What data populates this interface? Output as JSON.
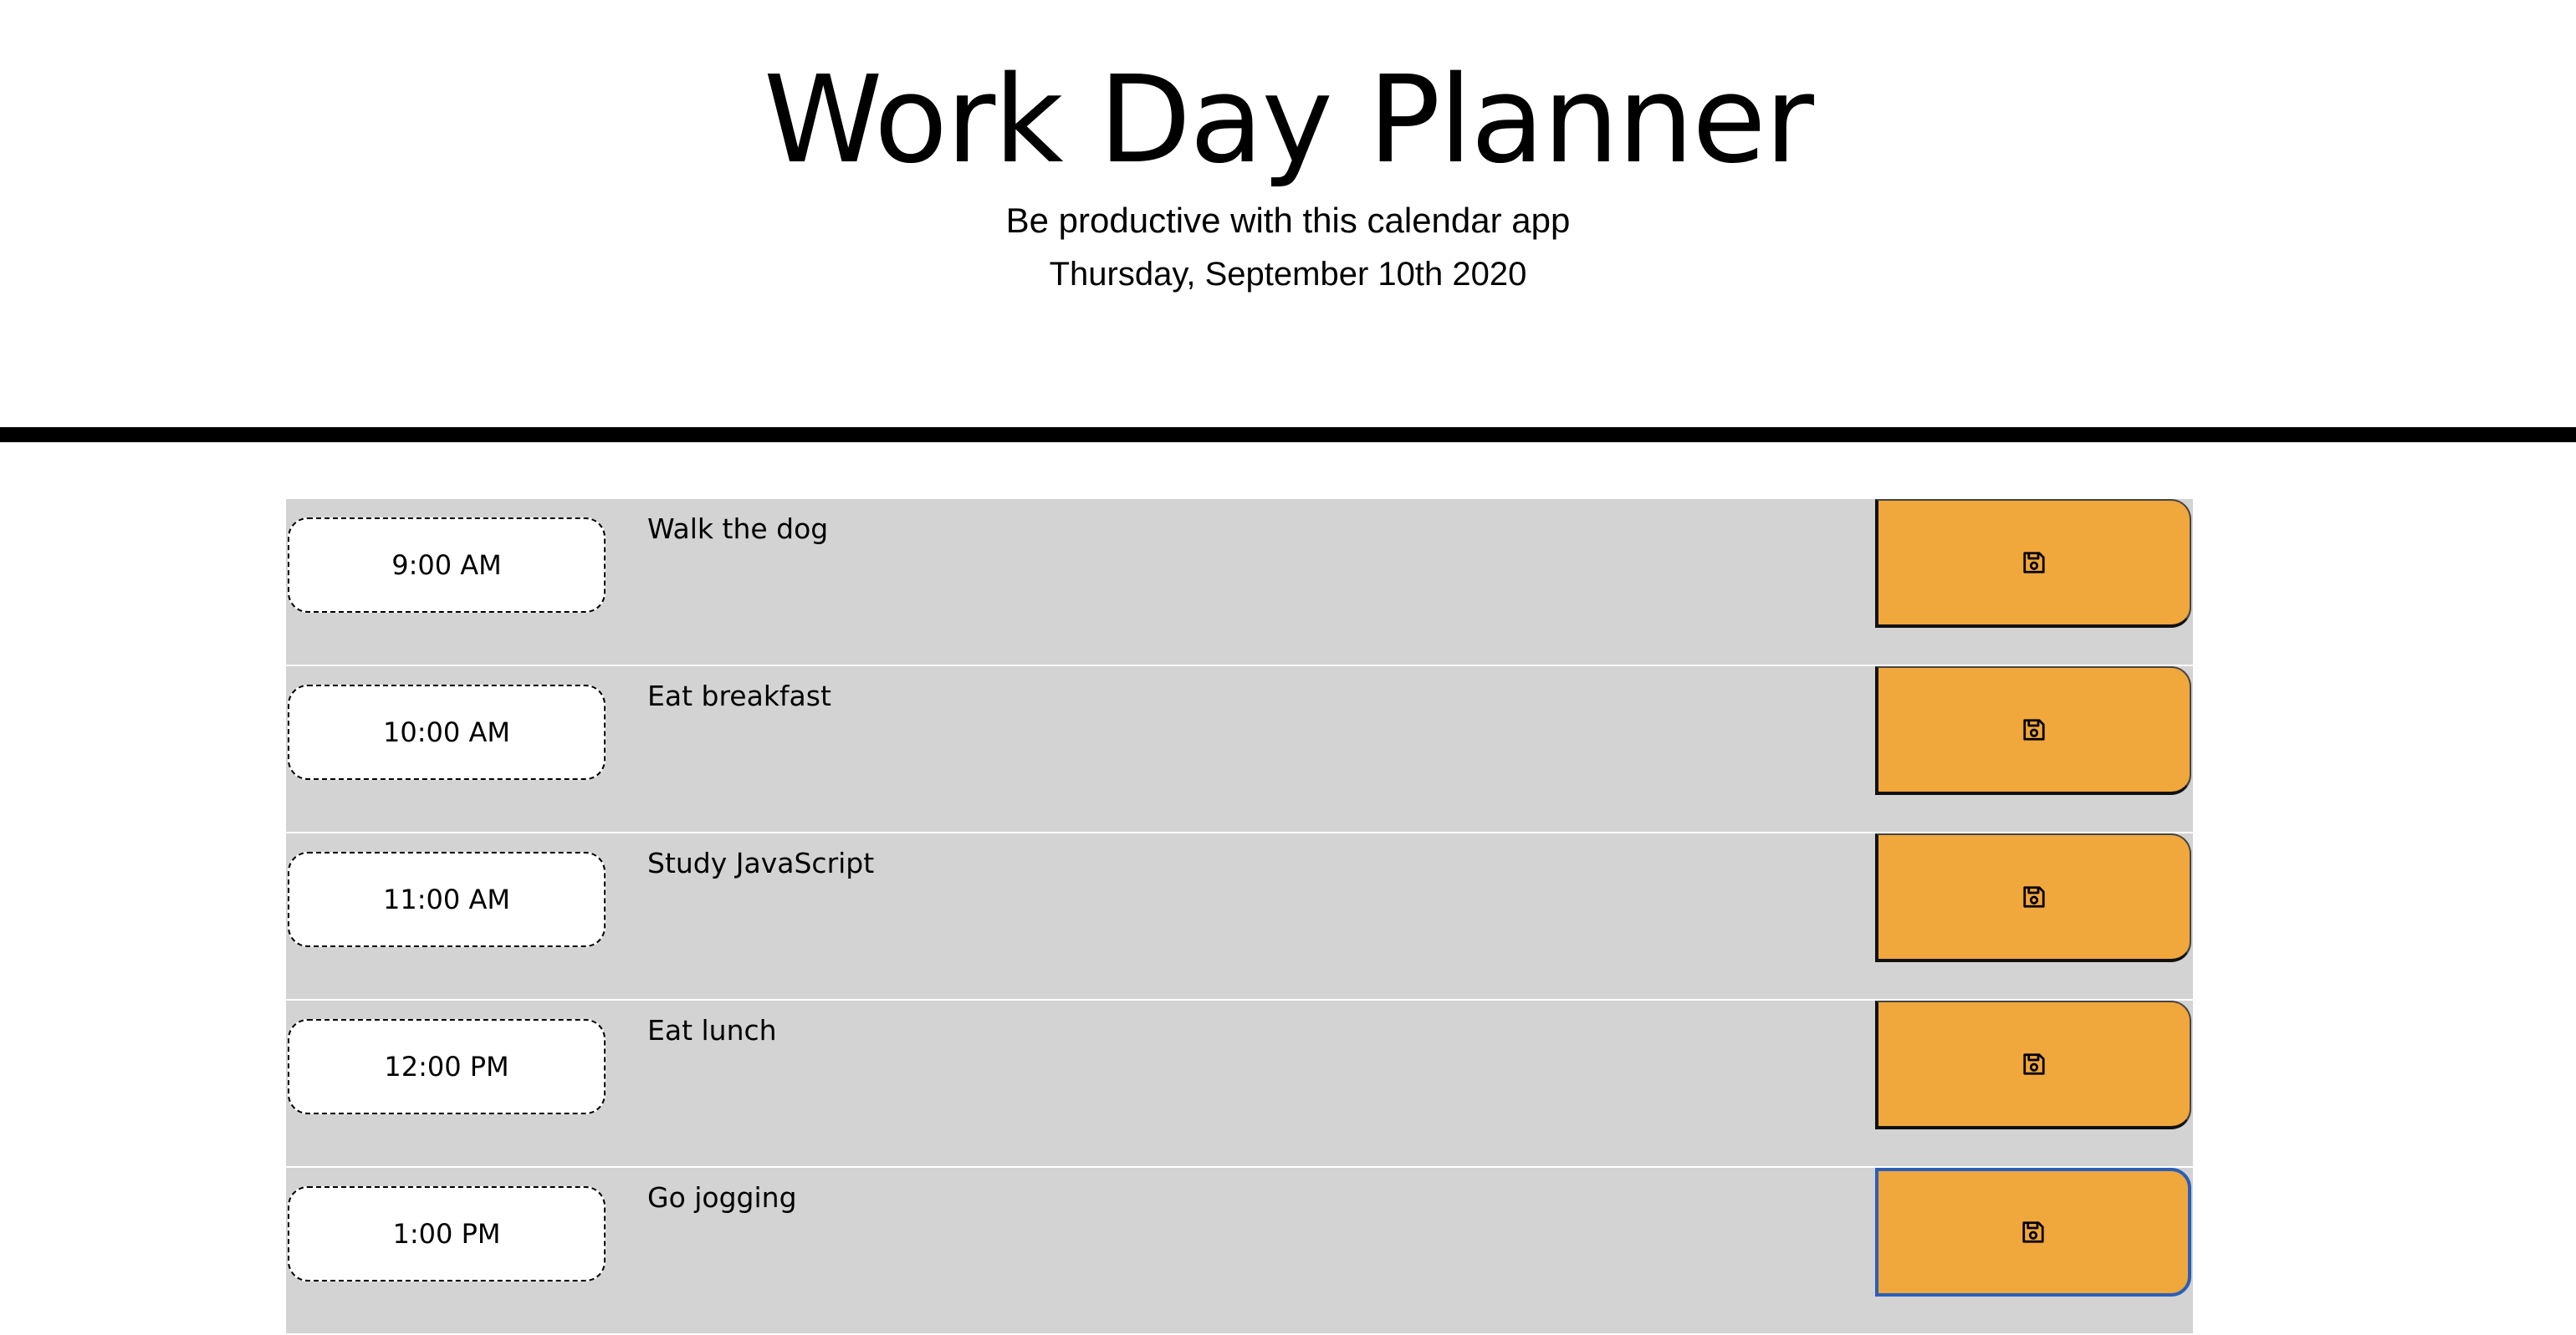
{
  "header": {
    "title": "Work Day Planner",
    "subtitle": "Be productive with this calendar app",
    "current_day": "Thursday, September 10th 2020"
  },
  "colors": {
    "row_background": "#d3d3d3",
    "save_button": "#f0a73c",
    "divider": "#000000"
  },
  "time_blocks": [
    {
      "hour": "9:00 AM",
      "description": "Walk the dog",
      "save_icon": "save-icon"
    },
    {
      "hour": "10:00 AM",
      "description": "Eat breakfast",
      "save_icon": "save-icon"
    },
    {
      "hour": "11:00 AM",
      "description": "Study JavaScript",
      "save_icon": "save-icon"
    },
    {
      "hour": "12:00 PM",
      "description": "Eat lunch",
      "save_icon": "save-icon"
    },
    {
      "hour": "1:00 PM",
      "description": "Go jogging",
      "save_icon": "save-icon"
    }
  ]
}
